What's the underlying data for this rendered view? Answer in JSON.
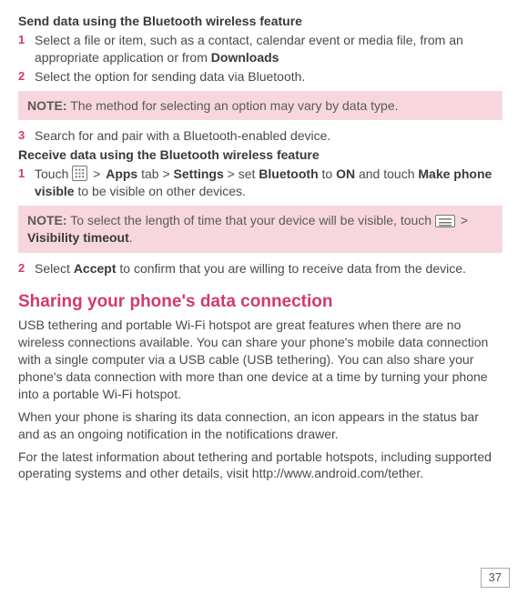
{
  "section1": {
    "title": "Send data using the Bluetooth wireless feature",
    "steps": [
      {
        "num": "1",
        "pre": "Select a file or item, such as a contact, calendar event or media file, from an appropriate application or from ",
        "b1": "Downloads"
      },
      {
        "num": "2",
        "pre": "Select the option for sending data via Bluetooth."
      }
    ],
    "note": {
      "label": "NOTE:",
      "text": " The method for selecting an option may vary by data type."
    },
    "step3": {
      "num": "3",
      "text": "Search for and pair with a Bluetooth-enabled device."
    }
  },
  "section2": {
    "title": "Receive data using the Bluetooth wireless feature",
    "steps": [
      {
        "num": "1",
        "t1": "Touch ",
        "gt": " > ",
        "b_apps": "Apps",
        "t_tab": " tab > ",
        "b_settings": "Settings",
        "t_set": " > set ",
        "b_bt": "Bluetooth",
        "t_to": " to ",
        "b_on": "ON",
        "t_and": " and touch ",
        "b_mpv": "Make phone visible",
        "t_end": " to be visible on other devices."
      }
    ],
    "note": {
      "label": "NOTE:",
      "t1": " To select the length of time that your device will be visible, touch ",
      "gt": " > ",
      "b_vt": "Visibility timeout",
      "dot": "."
    },
    "step2": {
      "num": "2",
      "t1": "Select ",
      "b_accept": "Accept",
      "t2": " to confirm that you are willing to receive data from the device."
    }
  },
  "section3": {
    "title": "Sharing your phone's data connection",
    "p1": "USB tethering and portable Wi-Fi hotspot are great features when there are no wireless connections available. You can share your phone's mobile data connection with a single computer via a USB cable (USB tethering). You can also share your phone's data connection with more than one device at a time by turning your phone into a portable Wi-Fi hotspot.",
    "p2": "When your phone is sharing its data connection, an icon appears in the status bar and as an ongoing notification in the notifications drawer.",
    "p3": "For the latest information about tethering and portable hotspots, including supported operating systems and other details, visit http://www.android.com/tether."
  },
  "page": "37"
}
